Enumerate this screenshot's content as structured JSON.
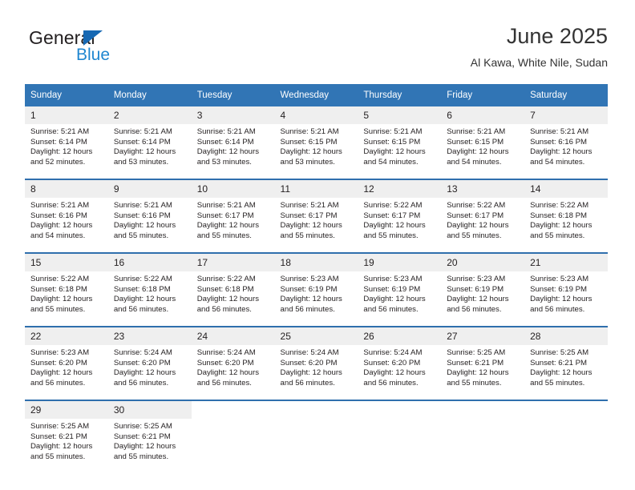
{
  "brand": {
    "name_part1": "General",
    "name_part2": "Blue",
    "triangle_icon": "triangle-icon",
    "accent_dark": "#1668b3",
    "accent_light": "#1f86d0"
  },
  "header": {
    "title": "June 2025",
    "location": "Al Kawa, White Nile, Sudan"
  },
  "calendar": {
    "header_bg": "#3175b5",
    "row_divider": "#2f6fad",
    "daynum_bg": "#efefef",
    "weekdays": [
      "Sunday",
      "Monday",
      "Tuesday",
      "Wednesday",
      "Thursday",
      "Friday",
      "Saturday"
    ],
    "weeks": [
      [
        {
          "day": "1",
          "sunrise": "Sunrise: 5:21 AM",
          "sunset": "Sunset: 6:14 PM",
          "daylight1": "Daylight: 12 hours",
          "daylight2": "and 52 minutes."
        },
        {
          "day": "2",
          "sunrise": "Sunrise: 5:21 AM",
          "sunset": "Sunset: 6:14 PM",
          "daylight1": "Daylight: 12 hours",
          "daylight2": "and 53 minutes."
        },
        {
          "day": "3",
          "sunrise": "Sunrise: 5:21 AM",
          "sunset": "Sunset: 6:14 PM",
          "daylight1": "Daylight: 12 hours",
          "daylight2": "and 53 minutes."
        },
        {
          "day": "4",
          "sunrise": "Sunrise: 5:21 AM",
          "sunset": "Sunset: 6:15 PM",
          "daylight1": "Daylight: 12 hours",
          "daylight2": "and 53 minutes."
        },
        {
          "day": "5",
          "sunrise": "Sunrise: 5:21 AM",
          "sunset": "Sunset: 6:15 PM",
          "daylight1": "Daylight: 12 hours",
          "daylight2": "and 54 minutes."
        },
        {
          "day": "6",
          "sunrise": "Sunrise: 5:21 AM",
          "sunset": "Sunset: 6:15 PM",
          "daylight1": "Daylight: 12 hours",
          "daylight2": "and 54 minutes."
        },
        {
          "day": "7",
          "sunrise": "Sunrise: 5:21 AM",
          "sunset": "Sunset: 6:16 PM",
          "daylight1": "Daylight: 12 hours",
          "daylight2": "and 54 minutes."
        }
      ],
      [
        {
          "day": "8",
          "sunrise": "Sunrise: 5:21 AM",
          "sunset": "Sunset: 6:16 PM",
          "daylight1": "Daylight: 12 hours",
          "daylight2": "and 54 minutes."
        },
        {
          "day": "9",
          "sunrise": "Sunrise: 5:21 AM",
          "sunset": "Sunset: 6:16 PM",
          "daylight1": "Daylight: 12 hours",
          "daylight2": "and 55 minutes."
        },
        {
          "day": "10",
          "sunrise": "Sunrise: 5:21 AM",
          "sunset": "Sunset: 6:17 PM",
          "daylight1": "Daylight: 12 hours",
          "daylight2": "and 55 minutes."
        },
        {
          "day": "11",
          "sunrise": "Sunrise: 5:21 AM",
          "sunset": "Sunset: 6:17 PM",
          "daylight1": "Daylight: 12 hours",
          "daylight2": "and 55 minutes."
        },
        {
          "day": "12",
          "sunrise": "Sunrise: 5:22 AM",
          "sunset": "Sunset: 6:17 PM",
          "daylight1": "Daylight: 12 hours",
          "daylight2": "and 55 minutes."
        },
        {
          "day": "13",
          "sunrise": "Sunrise: 5:22 AM",
          "sunset": "Sunset: 6:17 PM",
          "daylight1": "Daylight: 12 hours",
          "daylight2": "and 55 minutes."
        },
        {
          "day": "14",
          "sunrise": "Sunrise: 5:22 AM",
          "sunset": "Sunset: 6:18 PM",
          "daylight1": "Daylight: 12 hours",
          "daylight2": "and 55 minutes."
        }
      ],
      [
        {
          "day": "15",
          "sunrise": "Sunrise: 5:22 AM",
          "sunset": "Sunset: 6:18 PM",
          "daylight1": "Daylight: 12 hours",
          "daylight2": "and 55 minutes."
        },
        {
          "day": "16",
          "sunrise": "Sunrise: 5:22 AM",
          "sunset": "Sunset: 6:18 PM",
          "daylight1": "Daylight: 12 hours",
          "daylight2": "and 56 minutes."
        },
        {
          "day": "17",
          "sunrise": "Sunrise: 5:22 AM",
          "sunset": "Sunset: 6:18 PM",
          "daylight1": "Daylight: 12 hours",
          "daylight2": "and 56 minutes."
        },
        {
          "day": "18",
          "sunrise": "Sunrise: 5:23 AM",
          "sunset": "Sunset: 6:19 PM",
          "daylight1": "Daylight: 12 hours",
          "daylight2": "and 56 minutes."
        },
        {
          "day": "19",
          "sunrise": "Sunrise: 5:23 AM",
          "sunset": "Sunset: 6:19 PM",
          "daylight1": "Daylight: 12 hours",
          "daylight2": "and 56 minutes."
        },
        {
          "day": "20",
          "sunrise": "Sunrise: 5:23 AM",
          "sunset": "Sunset: 6:19 PM",
          "daylight1": "Daylight: 12 hours",
          "daylight2": "and 56 minutes."
        },
        {
          "day": "21",
          "sunrise": "Sunrise: 5:23 AM",
          "sunset": "Sunset: 6:19 PM",
          "daylight1": "Daylight: 12 hours",
          "daylight2": "and 56 minutes."
        }
      ],
      [
        {
          "day": "22",
          "sunrise": "Sunrise: 5:23 AM",
          "sunset": "Sunset: 6:20 PM",
          "daylight1": "Daylight: 12 hours",
          "daylight2": "and 56 minutes."
        },
        {
          "day": "23",
          "sunrise": "Sunrise: 5:24 AM",
          "sunset": "Sunset: 6:20 PM",
          "daylight1": "Daylight: 12 hours",
          "daylight2": "and 56 minutes."
        },
        {
          "day": "24",
          "sunrise": "Sunrise: 5:24 AM",
          "sunset": "Sunset: 6:20 PM",
          "daylight1": "Daylight: 12 hours",
          "daylight2": "and 56 minutes."
        },
        {
          "day": "25",
          "sunrise": "Sunrise: 5:24 AM",
          "sunset": "Sunset: 6:20 PM",
          "daylight1": "Daylight: 12 hours",
          "daylight2": "and 56 minutes."
        },
        {
          "day": "26",
          "sunrise": "Sunrise: 5:24 AM",
          "sunset": "Sunset: 6:20 PM",
          "daylight1": "Daylight: 12 hours",
          "daylight2": "and 56 minutes."
        },
        {
          "day": "27",
          "sunrise": "Sunrise: 5:25 AM",
          "sunset": "Sunset: 6:21 PM",
          "daylight1": "Daylight: 12 hours",
          "daylight2": "and 55 minutes."
        },
        {
          "day": "28",
          "sunrise": "Sunrise: 5:25 AM",
          "sunset": "Sunset: 6:21 PM",
          "daylight1": "Daylight: 12 hours",
          "daylight2": "and 55 minutes."
        }
      ],
      [
        {
          "day": "29",
          "sunrise": "Sunrise: 5:25 AM",
          "sunset": "Sunset: 6:21 PM",
          "daylight1": "Daylight: 12 hours",
          "daylight2": "and 55 minutes."
        },
        {
          "day": "30",
          "sunrise": "Sunrise: 5:25 AM",
          "sunset": "Sunset: 6:21 PM",
          "daylight1": "Daylight: 12 hours",
          "daylight2": "and 55 minutes."
        },
        {
          "day": "",
          "sunrise": "",
          "sunset": "",
          "daylight1": "",
          "daylight2": ""
        },
        {
          "day": "",
          "sunrise": "",
          "sunset": "",
          "daylight1": "",
          "daylight2": ""
        },
        {
          "day": "",
          "sunrise": "",
          "sunset": "",
          "daylight1": "",
          "daylight2": ""
        },
        {
          "day": "",
          "sunrise": "",
          "sunset": "",
          "daylight1": "",
          "daylight2": ""
        },
        {
          "day": "",
          "sunrise": "",
          "sunset": "",
          "daylight1": "",
          "daylight2": ""
        }
      ]
    ]
  }
}
